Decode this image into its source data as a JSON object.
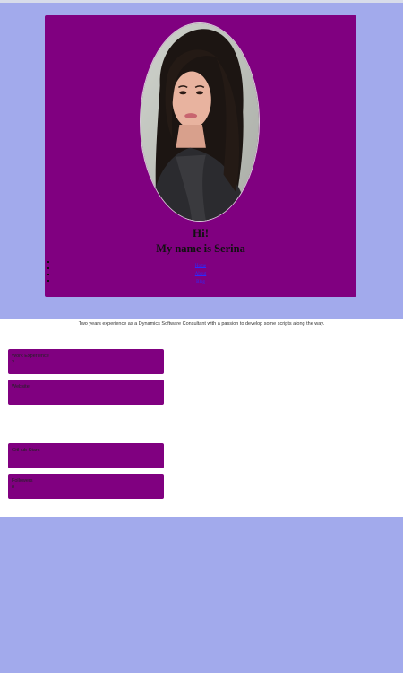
{
  "hero": {
    "greeting": "Hi!",
    "name_line": "My name is Serina",
    "links": [
      "Home",
      "About",
      "Blog"
    ]
  },
  "intro": "Two years experience as a Dynamics Software Consultant with a passion to develop some scripts along the way.",
  "items": [
    {
      "label": "Work Experience",
      "value": "2"
    },
    {
      "label": "Website",
      "value": ""
    },
    {
      "label": "GitHub Stars",
      "value": ""
    },
    {
      "label": "Followers",
      "value": "8"
    }
  ],
  "colors": {
    "page_background": "#a2aaec",
    "card": "#800080",
    "content_background": "#ffffff",
    "link": "#2a2aff"
  }
}
